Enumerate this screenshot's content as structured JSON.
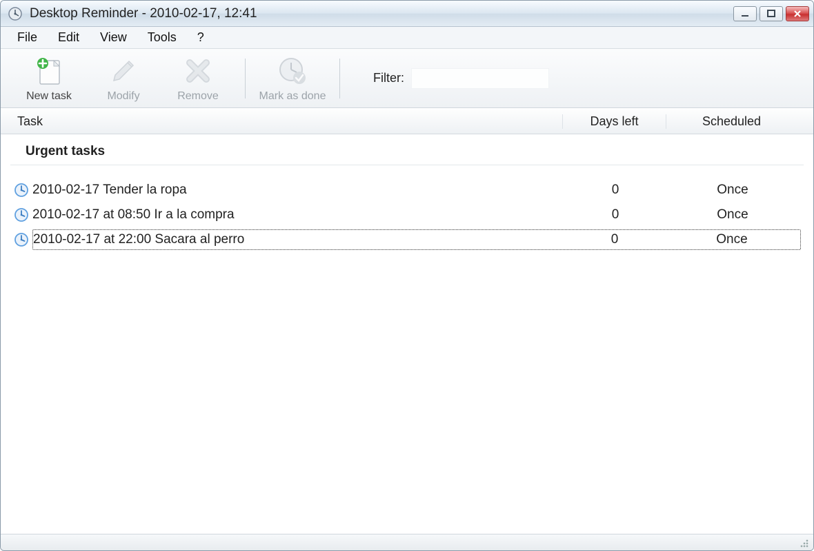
{
  "window": {
    "title": "Desktop Reminder - 2010-02-17, 12:41"
  },
  "menu": {
    "items": [
      "File",
      "Edit",
      "View",
      "Tools",
      "?"
    ]
  },
  "toolbar": {
    "new_task": "New task",
    "modify": "Modify",
    "remove": "Remove",
    "mark_done": "Mark as done",
    "filter_label": "Filter:",
    "filter_value": ""
  },
  "columns": {
    "task": "Task",
    "days_left": "Days left",
    "scheduled": "Scheduled"
  },
  "group": {
    "title": "Urgent tasks"
  },
  "tasks": [
    {
      "text": "2010-02-17 Tender la ropa",
      "days_left": "0",
      "scheduled": "Once",
      "selected": false
    },
    {
      "text": "2010-02-17 at 08:50 Ir a la compra",
      "days_left": "0",
      "scheduled": "Once",
      "selected": false
    },
    {
      "text": "2010-02-17 at 22:00 Sacara al perro",
      "days_left": "0",
      "scheduled": "Once",
      "selected": true
    }
  ]
}
